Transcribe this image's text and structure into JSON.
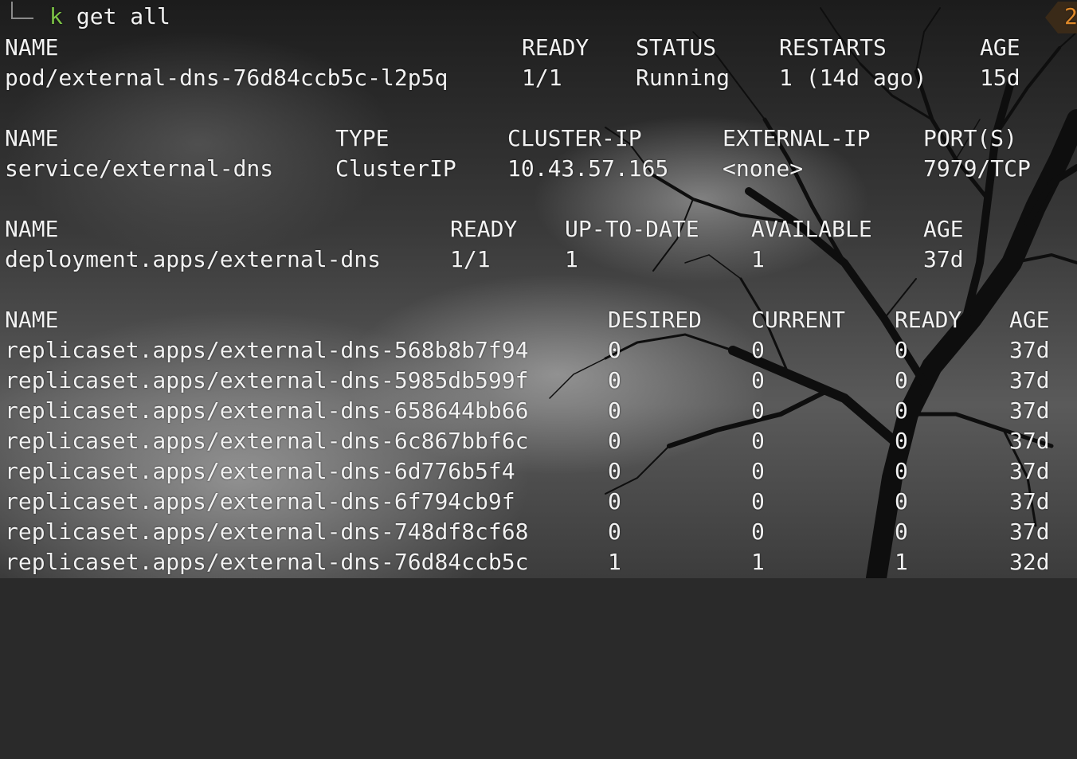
{
  "theme": {
    "prompt_color": "#7cc446",
    "text_color": "#f2f2f2",
    "badge_color": "#e08a2a"
  },
  "prompt": {
    "cmd_k": "k",
    "cmd_rest": " get all",
    "right_indicator": "2"
  },
  "pods": {
    "headers": [
      "NAME",
      "READY",
      "STATUS",
      "RESTARTS",
      "AGE"
    ],
    "rows": [
      [
        "pod/external-dns-76d84ccb5c-l2p5q",
        "1/1",
        "Running",
        "1 (14d ago)",
        "15d"
      ]
    ]
  },
  "services": {
    "headers": [
      "NAME",
      "TYPE",
      "CLUSTER-IP",
      "EXTERNAL-IP",
      "PORT(S)"
    ],
    "rows": [
      [
        "service/external-dns",
        "ClusterIP",
        "10.43.57.165",
        "<none>",
        "7979/TCP"
      ]
    ]
  },
  "deployments": {
    "headers": [
      "NAME",
      "READY",
      "UP-TO-DATE",
      "AVAILABLE",
      "AGE"
    ],
    "rows": [
      [
        "deployment.apps/external-dns",
        "1/1",
        "1",
        "1",
        "37d"
      ]
    ]
  },
  "replicasets": {
    "headers": [
      "NAME",
      "DESIRED",
      "CURRENT",
      "READY",
      "AGE"
    ],
    "rows": [
      [
        "replicaset.apps/external-dns-568b8b7f94",
        "0",
        "0",
        "0",
        "37d"
      ],
      [
        "replicaset.apps/external-dns-5985db599f",
        "0",
        "0",
        "0",
        "37d"
      ],
      [
        "replicaset.apps/external-dns-658644bb66",
        "0",
        "0",
        "0",
        "37d"
      ],
      [
        "replicaset.apps/external-dns-6c867bbf6c",
        "0",
        "0",
        "0",
        "37d"
      ],
      [
        "replicaset.apps/external-dns-6d776b5f4",
        "0",
        "0",
        "0",
        "37d"
      ],
      [
        "replicaset.apps/external-dns-6f794cb9f",
        "0",
        "0",
        "0",
        "37d"
      ],
      [
        "replicaset.apps/external-dns-748df8cf68",
        "0",
        "0",
        "0",
        "37d"
      ],
      [
        "replicaset.apps/external-dns-76d84ccb5c",
        "1",
        "1",
        "1",
        "32d"
      ]
    ]
  }
}
